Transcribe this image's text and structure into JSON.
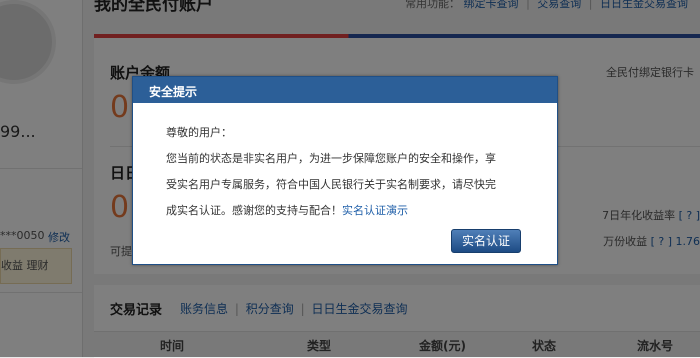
{
  "sidebar": {
    "account_number": "99...",
    "masked_account": "***0050",
    "modify_label": "修改",
    "subtabs": "收益 理财"
  },
  "header": {
    "title": "我的全民付账户",
    "quick_prefix": "常用功能：",
    "quick_links": [
      "绑定卡查询",
      "交易查询",
      "日日生金交易查询"
    ]
  },
  "balance": {
    "label": "账户余额",
    "amount": "0",
    "card_link": "全民付绑定银行卡"
  },
  "riri": {
    "label": "日日",
    "amount": "0",
    "left_text": "可提",
    "rate7_label": "7日年化收益率",
    "help": "[ ? ]",
    "wanfen_label": "万份收益",
    "wanfen_value": "1.76"
  },
  "transactions": {
    "title": "交易记录",
    "links": [
      "账务信息",
      "积分查询",
      "日日生金交易查询"
    ],
    "columns": [
      "时间",
      "类型",
      "金额(元)",
      "状态",
      "流水号"
    ]
  },
  "modal": {
    "title": "安全提示",
    "greeting": "尊敬的用户：",
    "line1": "您当前的状态是非实名用户，为进一步保障您账户的安全和操作，享",
    "line2": "受实名用户专属服务，符合中国人民银行关于实名制要求，请尽快完",
    "line3": "成实名认证。感谢您的支持与配合！",
    "demo_link": "实名认证演示",
    "button": "实名认证"
  },
  "colors": {
    "accent": "#2c5f98",
    "balance": "#e8773b",
    "link": "#1e5ea8"
  }
}
